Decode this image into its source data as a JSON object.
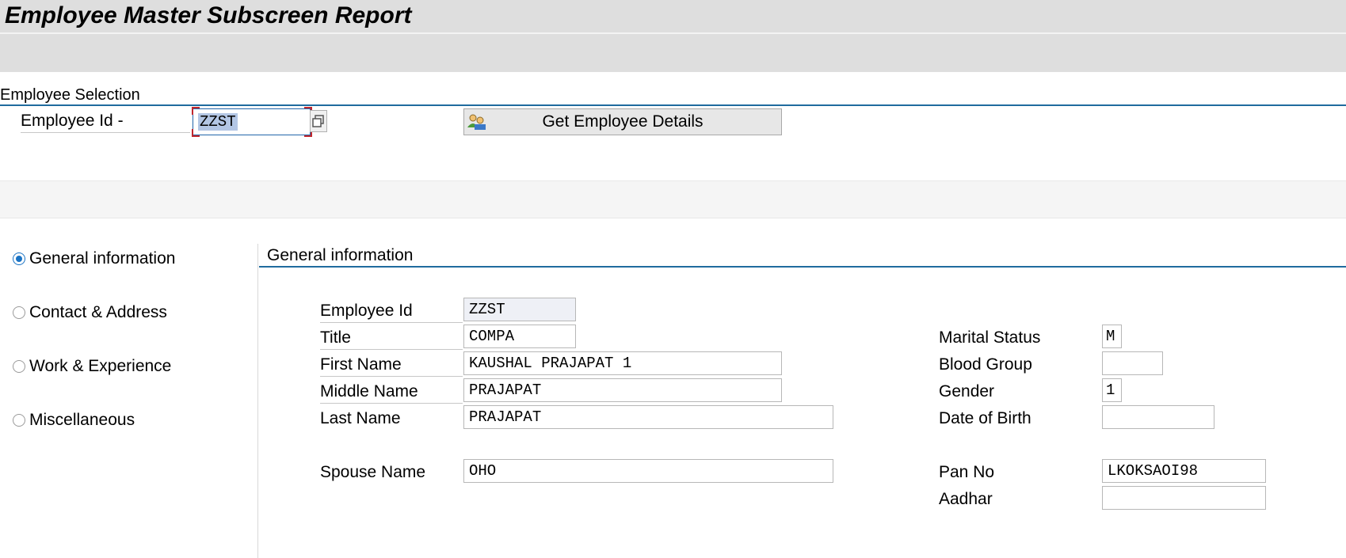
{
  "title": "Employee Master Subscreen Report",
  "selection": {
    "frame_label": "Employee Selection",
    "employee_id_label": "Employee Id -",
    "employee_id_value": "ZZST",
    "get_details_button": "Get Employee Details"
  },
  "tabs": [
    {
      "label": "General information",
      "selected": true
    },
    {
      "label": "Contact & Address",
      "selected": false
    },
    {
      "label": "Work & Experience",
      "selected": false
    },
    {
      "label": "Miscellaneous",
      "selected": false
    }
  ],
  "general": {
    "frame_label": "General information",
    "left_fields": [
      {
        "label": "Employee Id",
        "value": "ZZST"
      },
      {
        "label": "Title",
        "value": "COMPA"
      },
      {
        "label": "First Name",
        "value": "KAUSHAL PRAJAPAT 1"
      },
      {
        "label": "Middle Name",
        "value": "PRAJAPAT"
      },
      {
        "label": "Last Name",
        "value": "PRAJAPAT"
      },
      {
        "label": "Spouse Name",
        "value": "OHO"
      }
    ],
    "right_fields": [
      {
        "label": "Marital Status",
        "value": "M"
      },
      {
        "label": "Blood Group",
        "value": ""
      },
      {
        "label": "Gender",
        "value": "1"
      },
      {
        "label": "Date of Birth",
        "value": ""
      },
      {
        "label": "Pan No",
        "value": "LKOKSAOI98"
      },
      {
        "label": "Aadhar",
        "value": ""
      }
    ]
  },
  "icons": {
    "f4_help": "value-help-icon",
    "employee": "employee-group-icon"
  }
}
